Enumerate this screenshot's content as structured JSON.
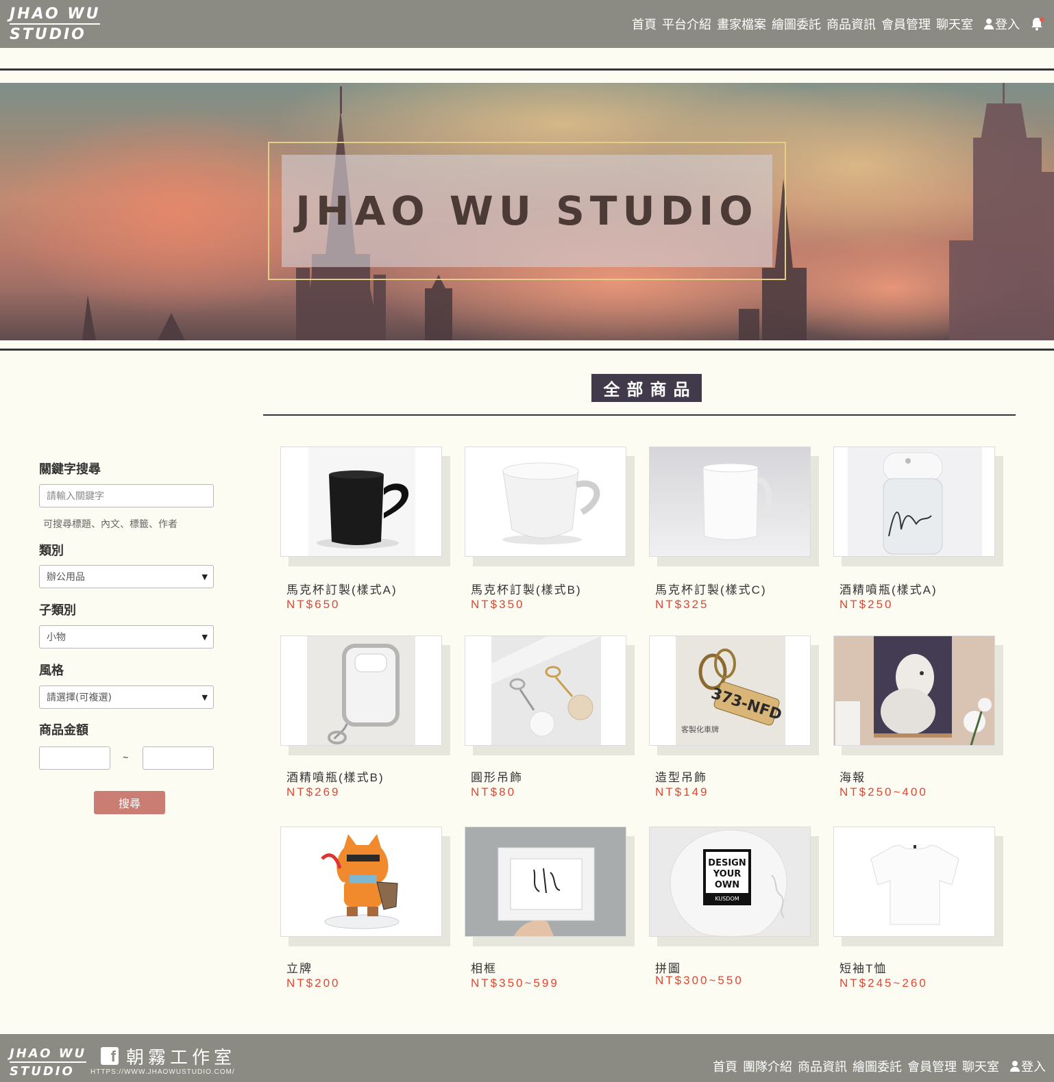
{
  "header": {
    "logo_line1": "JHAO WU",
    "logo_line2": "STUDIO",
    "nav": [
      "首頁",
      "平台介紹",
      "畫家檔案",
      "繪圖委託",
      "商品資訊",
      "會員管理",
      "聊天室"
    ],
    "login": "登入"
  },
  "hero": {
    "title": "JHAO WU STUDIO"
  },
  "section": {
    "title": "全部商品"
  },
  "sidebar": {
    "keyword_label": "關鍵字搜尋",
    "keyword_placeholder": "請輸入關鍵字",
    "keyword_hint": "可搜尋標題、內文、標籤、作者",
    "category_label": "類別",
    "category_value": "辦公用品",
    "subcategory_label": "子類別",
    "subcategory_value": "小物",
    "style_label": "風格",
    "style_value": "請選擇(可複選)",
    "price_label": "商品金額",
    "price_separator": "~",
    "search_button": "搜尋"
  },
  "products": [
    {
      "name": "馬克杯訂製(樣式A)",
      "price": "NT$650",
      "image": "black-heart-mug"
    },
    {
      "name": "馬克杯訂製(樣式B)",
      "price": "NT$350",
      "image": "white-cup"
    },
    {
      "name": "馬克杯訂製(樣式C)",
      "price": "NT$325",
      "image": "white-mug"
    },
    {
      "name": "酒精噴瓶(樣式A)",
      "price": "NT$250",
      "image": "spray-bottle-nancy"
    },
    {
      "name": "酒精噴瓶(樣式B)",
      "price": "NT$269",
      "image": "spray-bottle-gray"
    },
    {
      "name": "圓形吊飾",
      "price": "NT$80",
      "image": "round-keychains"
    },
    {
      "name": "造型吊飾",
      "price": "NT$149",
      "image": "plate-keychain"
    },
    {
      "name": "海報",
      "price": "NT$250~400",
      "image": "dog-poster"
    },
    {
      "name": "立牌",
      "price": "NT$200",
      "image": "cat-standee"
    },
    {
      "name": "相框",
      "price": "NT$350~599",
      "image": "photo-frame"
    },
    {
      "name": "拼圖",
      "price": "NT$300~550",
      "image": "puzzle"
    },
    {
      "name": "短袖T恤",
      "price": "NT$245~260",
      "image": "white-tshirt"
    }
  ],
  "product_images": {
    "keychain_plate_text": "373-NFD",
    "keychain_caption": "客製化車牌",
    "puzzle_text": [
      "DESIGN",
      "YOUR",
      "OWN",
      "KUSDOM"
    ]
  },
  "footer": {
    "logo_line1": "JHAO WU",
    "logo_line2": "STUDIO",
    "fb_letter": "f",
    "studio_name": "朝霧工作室",
    "url": "HTTPS://WWW.JHAOWUSTUDIO.COM/",
    "nav": [
      "首頁",
      "團隊介紹",
      "商品資訊",
      "繪圖委託",
      "會員管理",
      "聊天室"
    ],
    "login": "登入"
  },
  "colors": {
    "header_bg": "#8b8b83",
    "accent_price": "#e0452f",
    "search_button": "#c97d73",
    "section_title_bg": "#413a4a",
    "page_bg": "#fcfcf3"
  }
}
